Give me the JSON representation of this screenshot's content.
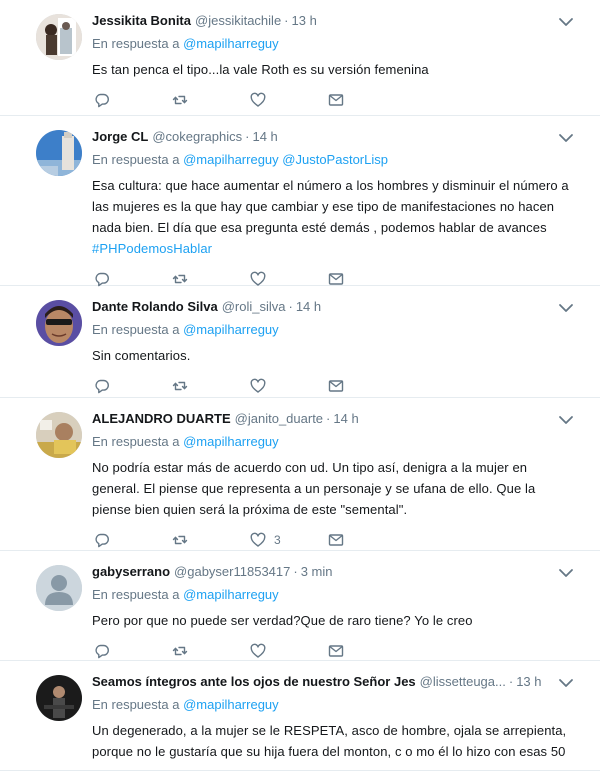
{
  "tweets": [
    {
      "name": "Jessikita Bonita",
      "handle": "@jessikitachile",
      "time": "13 h",
      "reply_prefix": "En respuesta a",
      "mentions": [
        "@mapilharreguy"
      ],
      "text_lines": [
        "Es tan penca el tipo...la vale Roth es su versión femenina"
      ],
      "hashtag": "",
      "like_count": "",
      "avatar_icon": "profile-photo"
    },
    {
      "name": "Jorge CL",
      "handle": "@cokegraphics",
      "time": "14 h",
      "reply_prefix": "En respuesta a",
      "mentions": [
        "@mapilharreguy",
        "@JustoPastorLisp"
      ],
      "text_lines": [
        "Esa cultura: que hace aumentar el número a los hombres y disminuir el número a",
        "las mujeres es la que hay que cambiar y ese tipo de manifestaciones no hacen",
        "nada bien. El día que esa pregunta esté demás , podemos hablar de avances"
      ],
      "hashtag": "#PHPodemosHablar",
      "like_count": "",
      "avatar_icon": "profile-photo"
    },
    {
      "name": "Dante Rolando Silva",
      "handle": "@roli_silva",
      "time": "14 h",
      "reply_prefix": "En respuesta a",
      "mentions": [
        "@mapilharreguy"
      ],
      "text_lines": [
        "Sin comentarios."
      ],
      "hashtag": "",
      "like_count": "",
      "avatar_icon": "profile-photo"
    },
    {
      "name": "ALEJANDRO DUARTE",
      "handle": "@janito_duarte",
      "time": "14 h",
      "reply_prefix": "En respuesta a",
      "mentions": [
        "@mapilharreguy"
      ],
      "text_lines": [
        "No podría estar más de acuerdo con ud.  Un tipo así, denigra a la mujer en",
        "general.  El piense que representa a un personaje y se ufana de ello.  Que la",
        "piense bien quien será la próxima de este \"semental\"."
      ],
      "hashtag": "",
      "like_count": "3",
      "avatar_icon": "profile-photo"
    },
    {
      "name": "gabyserrano",
      "handle": "@gabyser11853417",
      "time": "3 min",
      "reply_prefix": "En respuesta a",
      "mentions": [
        "@mapilharreguy"
      ],
      "text_lines": [
        "Pero por que no puede ser verdad?Que de raro tiene? Yo le creo"
      ],
      "hashtag": "",
      "like_count": "",
      "avatar_icon": "default-avatar-icon"
    },
    {
      "name": "Seamos íntegros ante los ojos de nuestro Señor Jes",
      "handle": "@lissetteuga...",
      "time": "13 h",
      "reply_prefix": "En respuesta a",
      "mentions": [
        "@mapilharreguy"
      ],
      "text_lines": [
        "Un degenerado, a la mujer se le RESPETA, asco de hombre, ojala se arrepienta,",
        "porque no le gustaría que su hija fuera del monton, c o mo él lo hizo con esas 50"
      ],
      "hashtag": "",
      "like_count": "",
      "avatar_icon": "profile-photo"
    }
  ],
  "colors": {
    "link": "#1da1f2",
    "secondary_text": "#657786",
    "divider": "#e6ecf0",
    "primary_text": "#14171a"
  },
  "action_icons": [
    "reply-icon",
    "retweet-icon",
    "like-icon",
    "direct-message-icon"
  ]
}
